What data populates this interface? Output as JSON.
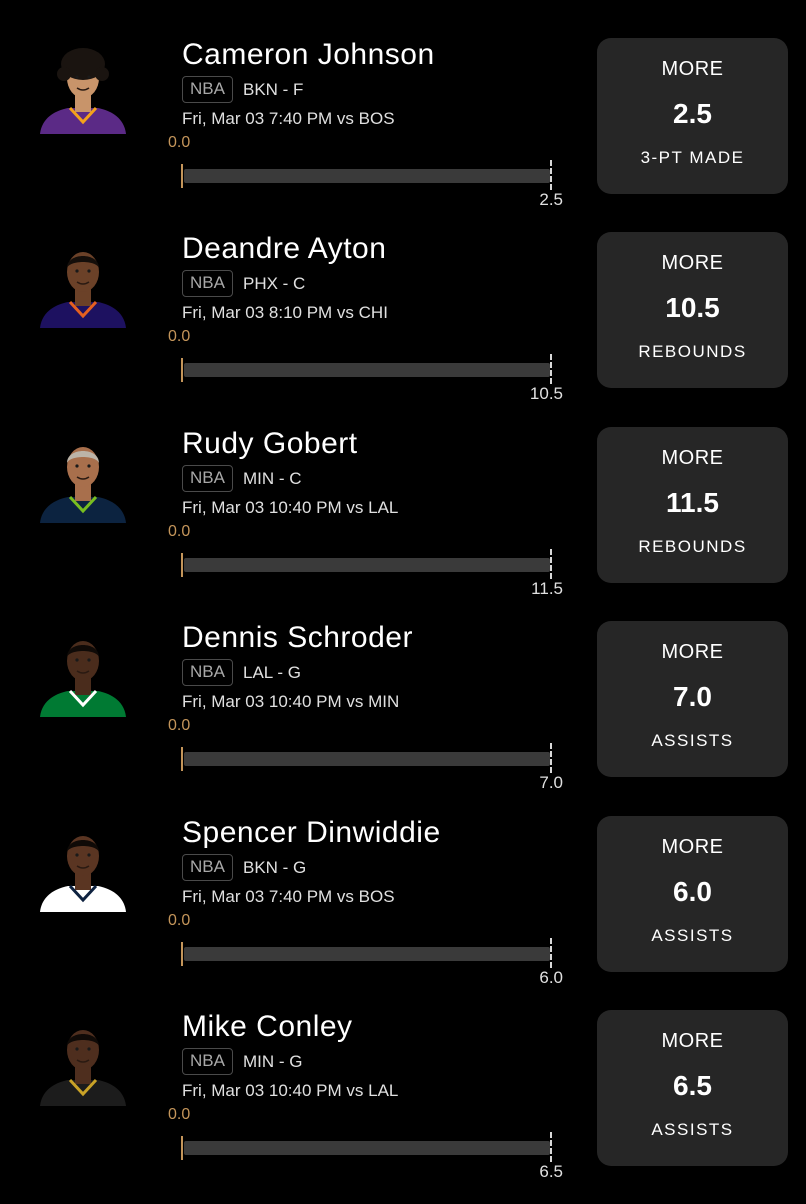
{
  "colors": {
    "background": "#000000",
    "card": "#262626",
    "accent": "#c4955a",
    "track": "#3a3a3a",
    "badge_border": "#4a4a4a",
    "muted_text": "#a8a8a8"
  },
  "props": [
    {
      "player": "Cameron Johnson",
      "league": "NBA",
      "team_pos": "BKN - F",
      "game": "Fri, Mar 03 7:40 PM  vs BOS",
      "current": "0.0",
      "line": "2.5",
      "progress": 0,
      "direction": "MORE",
      "stat": "3-PT MADE",
      "avatar": {
        "icon": "player-headshot-icon",
        "skin": "#c8946a",
        "hair": "#1a1410",
        "hair_style": "curly",
        "jersey": "#5b2a86",
        "trim": "#f4a11b"
      }
    },
    {
      "player": "Deandre Ayton",
      "league": "NBA",
      "team_pos": "PHX - C",
      "game": "Fri, Mar 03 8:10 PM  vs CHI",
      "current": "0.0",
      "line": "10.5",
      "progress": 0,
      "direction": "MORE",
      "stat": "REBOUNDS",
      "avatar": {
        "icon": "player-headshot-icon",
        "skin": "#6b4128",
        "hair": "#140e0a",
        "hair_style": "short",
        "jersey": "#1d1160",
        "trim": "#e56020"
      }
    },
    {
      "player": "Rudy Gobert",
      "league": "NBA",
      "team_pos": "MIN - C",
      "game": "Fri, Mar 03 10:40 PM  vs LAL",
      "current": "0.0",
      "line": "11.5",
      "progress": 0,
      "direction": "MORE",
      "stat": "REBOUNDS",
      "avatar": {
        "icon": "player-headshot-icon",
        "skin": "#a86f4c",
        "hair": "#bcb4a8",
        "hair_style": "short",
        "jersey": "#0c2340",
        "trim": "#78be20"
      }
    },
    {
      "player": "Dennis Schroder",
      "league": "NBA",
      "team_pos": "LAL - G",
      "game": "Fri, Mar 03 10:40 PM  vs MIN",
      "current": "0.0",
      "line": "7.0",
      "progress": 0,
      "direction": "MORE",
      "stat": "ASSISTS",
      "avatar": {
        "icon": "player-headshot-icon",
        "skin": "#4a2c1c",
        "hair": "#0f0a07",
        "hair_style": "short",
        "jersey": "#007a33",
        "trim": "#ffffff"
      }
    },
    {
      "player": "Spencer Dinwiddie",
      "league": "NBA",
      "team_pos": "BKN - G",
      "game": "Fri, Mar 03 7:40 PM  vs BOS",
      "current": "0.0",
      "line": "6.0",
      "progress": 0,
      "direction": "MORE",
      "stat": "ASSISTS",
      "avatar": {
        "icon": "player-headshot-icon",
        "skin": "#5a3522",
        "hair": "#0f0a07",
        "hair_style": "short",
        "jersey": "#ffffff",
        "trim": "#0e2240"
      }
    },
    {
      "player": "Mike Conley",
      "league": "NBA",
      "team_pos": "MIN - G",
      "game": "Fri, Mar 03 10:40 PM  vs LAL",
      "current": "0.0",
      "line": "6.5",
      "progress": 0,
      "direction": "MORE",
      "stat": "ASSISTS",
      "avatar": {
        "icon": "player-headshot-icon",
        "skin": "#4e2e1e",
        "hair": "#0f0a07",
        "hair_style": "short",
        "jersey": "#1c1c1c",
        "trim": "#c9a227"
      }
    }
  ]
}
